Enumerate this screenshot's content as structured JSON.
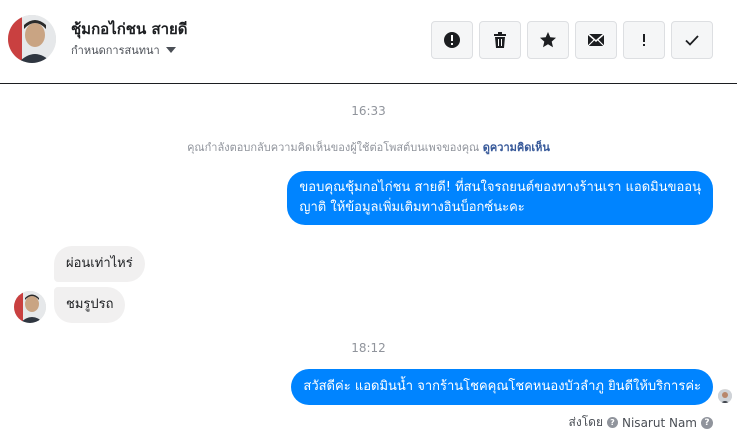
{
  "header": {
    "contact_name": "ชุ้มกอไก่ชน สายดี",
    "assign_label": "กำหนดการสนทนา",
    "tools": [
      {
        "icon": "alert-circle-icon"
      },
      {
        "icon": "trash-icon"
      },
      {
        "icon": "star-icon"
      },
      {
        "icon": "envelope-icon"
      },
      {
        "icon": "exclamation-icon",
        "label": "!"
      },
      {
        "icon": "checkmark-icon"
      }
    ]
  },
  "conversation": {
    "time_1": "16:33",
    "notice_text": "คุณกำลังตอบกลับความคิดเห็นของผู้ใช้ต่อโพสต์บนเพจของคุณ",
    "notice_link": "ดูความคิดเห็น",
    "msg_out_1_line1": "ขอบคุณชุ้มกอไก่ชน สายดี! ที่สนใจรถยนต์ของทางร้านเรา แอดมินขออนุ",
    "msg_out_1_line2": "ญาติ ให้ข้อมูลเพิ่มเติมทางอินบ็อกซ์นะคะ",
    "msg_in_1": "ผ่อนเท่าไหร่",
    "msg_in_2": "ชมรูปรถ",
    "time_2": "18:12",
    "msg_out_2": "สวัสดีค่ะ แอดมินน้ำ จากร้านโชคคุณโชคหนองบัวลำภู ยินดีให้บริการค่ะ",
    "sent_by_label": "ส่งโดย",
    "sender_name": "Nisarut Nam",
    "help_mark": "?"
  },
  "colors": {
    "outgoing_bubble": "#0084ff",
    "incoming_bubble": "#f1f0f0",
    "link": "#365899",
    "muted_text": "#90949c"
  }
}
